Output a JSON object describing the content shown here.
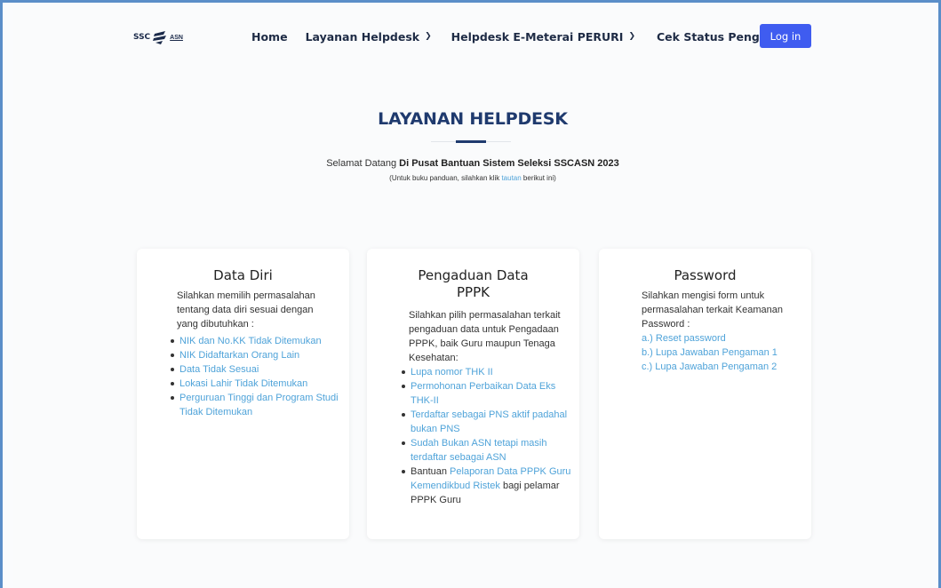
{
  "nav": {
    "logo_text": "SSC",
    "logo_suffix": "ASN",
    "home": "Home",
    "layanan_helpdesk": "Layanan Helpdesk",
    "helpdesk_emeterai": "Helpdesk E-Meterai PERURI",
    "cek_status": "Cek Status Pengaduan",
    "login": "Log in"
  },
  "hero": {
    "title": "LAYANAN HELPDESK",
    "welcome_prefix": "Selamat Datang ",
    "welcome_bold": "Di Pusat Bantuan Sistem Seleksi SSCASN 2023",
    "guide_prefix": "(Untuk buku panduan, silahkan klik ",
    "guide_link": "tautan",
    "guide_suffix": " berikut ini)"
  },
  "cards": [
    {
      "title": "Data Diri",
      "intro": "Silahkan memilih permasalahan tentang data diri sesuai dengan yang dibutuhkan :",
      "items": [
        "NIK dan No.KK Tidak Ditemukan",
        "NIK Didaftarkan Orang Lain",
        "Data Tidak Sesuai",
        "Lokasi Lahir Tidak Ditemukan",
        "Perguruan Tinggi dan Program Studi Tidak Ditemukan"
      ]
    },
    {
      "title": "Pengaduan Data PPPK",
      "intro": "Silahkan pilih permasalahan terkait pengaduan data untuk Pengadaan PPPK, baik Guru maupun Tenaga Kesehatan:",
      "items": [
        "Lupa nomor THK II",
        "Permohonan Perbaikan Data Eks THK-II",
        "Terdaftar sebagai PNS aktif padahal bukan PNS",
        "Sudah Bukan ASN tetapi masih terdaftar sebagai ASN"
      ],
      "last_item_prefix": "Bantuan ",
      "last_item_link": "Pelaporan Data PPPK Guru Kemendikbud Ristek",
      "last_item_suffix": " bagi pelamar PPPK Guru"
    },
    {
      "title": "Password",
      "intro": "Silahkan mengisi form untuk permasalahan terkait Keamanan Password :",
      "items": [
        "a.) Reset password",
        "b.) Lupa Jawaban Pengaman 1",
        "c.) Lupa Jawaban Pengaman 2"
      ]
    }
  ],
  "colors": {
    "primary_button": "#3f5cf0",
    "title_navy": "#1f3a6e",
    "link_blue": "#4fa3d9"
  }
}
